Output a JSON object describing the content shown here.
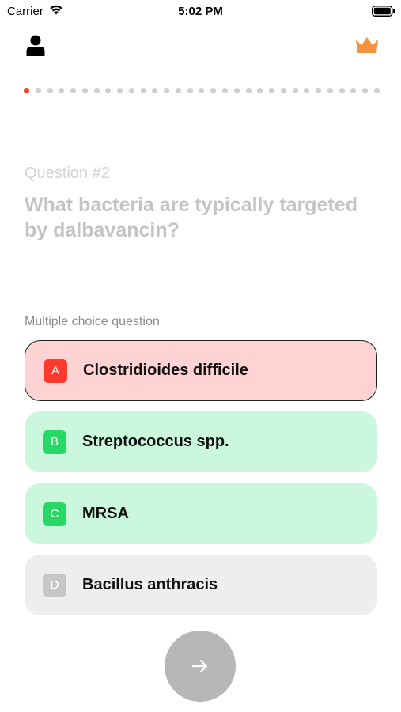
{
  "status_bar": {
    "carrier": "Carrier",
    "time": "5:02 PM",
    "icons": [
      "wifi-icon",
      "battery-icon"
    ]
  },
  "header": {
    "profile_icon": "person-icon",
    "premium_icon": "crown-icon",
    "premium_color": "#f4933c"
  },
  "progress": {
    "total_steps": 31,
    "current_index": 0,
    "active_color": "#ff3b30",
    "inactive_color": "#cfcfcf"
  },
  "question": {
    "number_label": "Question #2",
    "text": "What bacteria are typically targeted by dalbavancin?",
    "type_label": "Multiple choice question"
  },
  "options": [
    {
      "letter": "A",
      "text": "Clostridioides difficile",
      "state": "wrong",
      "badge_color": "#ff3b30"
    },
    {
      "letter": "B",
      "text": "Streptococcus spp.",
      "state": "correct",
      "badge_color": "#27d864"
    },
    {
      "letter": "C",
      "text": "MRSA",
      "state": "correct",
      "badge_color": "#27d864"
    },
    {
      "letter": "D",
      "text": "Bacillus anthracis",
      "state": "neutral",
      "badge_color": "#c7c7c7"
    }
  ],
  "next_button": {
    "icon": "arrow-right-icon",
    "color": "#b7b7b7"
  }
}
